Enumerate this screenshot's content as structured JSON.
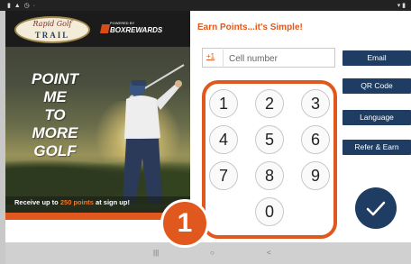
{
  "hero": {
    "logo_script": "Rapid Golf",
    "logo_trail": "TRAIL",
    "powered_by": "POWERED BY",
    "brand": "BOXREWARDS",
    "tagline": [
      "POINT",
      "ME",
      "TO",
      "MORE",
      "GOLF"
    ],
    "signup_pre": "Receive up to ",
    "signup_highlight": "250 points",
    "signup_post": " at sign up!"
  },
  "form": {
    "heading": "Earn Points...it's Simple!",
    "country_code": "+1",
    "cell_placeholder": "Cell number"
  },
  "keypad": {
    "keys": [
      "1",
      "2",
      "3",
      "4",
      "5",
      "6",
      "7",
      "8",
      "9",
      "0"
    ]
  },
  "side_buttons": {
    "email": "Email",
    "qr_code": "QR Code",
    "language": "Language",
    "refer_earn": "Refer & Earn"
  },
  "badge": {
    "label": "1"
  },
  "colors": {
    "accent": "#e0581d",
    "navy": "#1f3c62"
  },
  "icons": [
    "check-icon",
    "recent-apps-icon",
    "home-icon",
    "back-icon"
  ]
}
